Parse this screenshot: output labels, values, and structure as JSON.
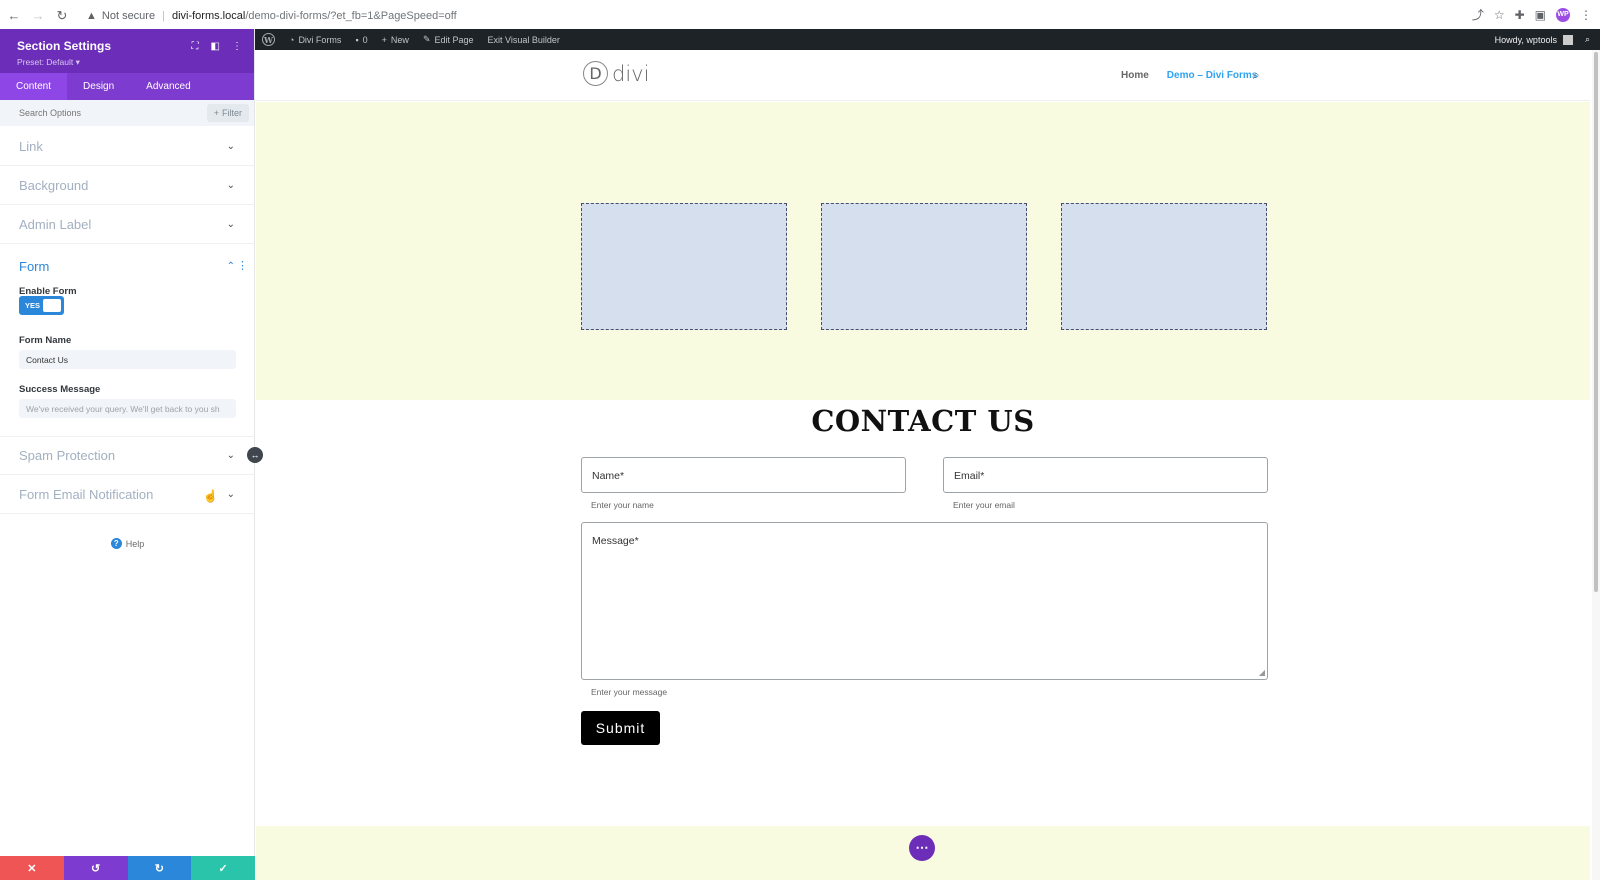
{
  "browser": {
    "security_label": "Not secure",
    "url_host": "divi-forms.local",
    "url_path": "/demo-divi-forms/?et_fb=1&PageSpeed=off",
    "profile_initials": "WP"
  },
  "wp_admin_bar": {
    "site_name": "Divi Forms",
    "comments_count": "0",
    "new_label": "New",
    "edit_page_label": "Edit Page",
    "exit_builder_label": "Exit Visual Builder",
    "greeting": "Howdy, wptools"
  },
  "panel": {
    "title": "Section Settings",
    "preset": "Preset: Default ▾",
    "tabs": [
      {
        "label": "Content",
        "active": true
      },
      {
        "label": "Design",
        "active": false
      },
      {
        "label": "Advanced",
        "active": false
      }
    ],
    "search_placeholder": "Search Options",
    "filter_label": "Filter",
    "groups": [
      {
        "label": "Link"
      },
      {
        "label": "Background"
      },
      {
        "label": "Admin Label"
      }
    ],
    "form_group": {
      "title": "Form",
      "enable_form_label": "Enable Form",
      "enable_form_value": "YES",
      "form_name_label": "Form Name",
      "form_name_value": "Contact Us",
      "success_message_label": "Success Message",
      "success_message_placeholder": "We've received your query. We'll get back to you sh"
    },
    "groups_after": [
      {
        "label": "Spam Protection"
      },
      {
        "label": "Form Email Notification"
      }
    ],
    "help_label": "Help"
  },
  "site": {
    "logo_letter": "D",
    "logo_text": "divi",
    "nav": [
      {
        "label": "Home",
        "current": false
      },
      {
        "label": "Demo – Divi Forms",
        "current": true
      }
    ]
  },
  "contact": {
    "title": "CONTACT US",
    "name_label": "Name*",
    "name_help": "Enter your name",
    "email_label": "Email*",
    "email_help": "Enter your email",
    "message_label": "Message*",
    "message_help": "Enter your message",
    "submit_label": "Submit"
  },
  "colors": {
    "builder_purple": "#6c2eb9",
    "divi_blue": "#2b87da",
    "section_bg": "#f8fbe0",
    "placeholder_box": "#d5dfed",
    "footer_discard": "#ef5555",
    "footer_undo": "#7e3bd0",
    "footer_redo": "#2b87da",
    "footer_save": "#29c4a9"
  }
}
